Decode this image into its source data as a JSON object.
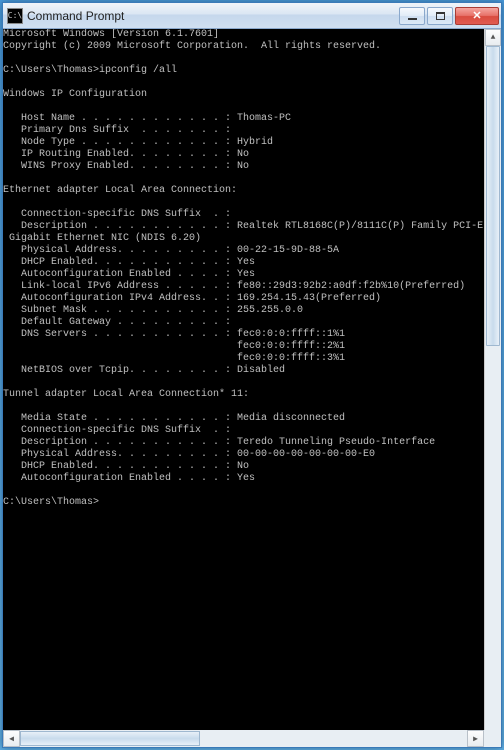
{
  "window": {
    "title": "Command Prompt"
  },
  "terminal": {
    "lines": [
      "Microsoft Windows [Version 6.1.7601]",
      "Copyright (c) 2009 Microsoft Corporation.  All rights reserved.",
      "",
      "C:\\Users\\Thomas>ipconfig /all",
      "",
      "Windows IP Configuration",
      "",
      "   Host Name . . . . . . . . . . . . : Thomas-PC",
      "   Primary Dns Suffix  . . . . . . . :",
      "   Node Type . . . . . . . . . . . . : Hybrid",
      "   IP Routing Enabled. . . . . . . . : No",
      "   WINS Proxy Enabled. . . . . . . . : No",
      "",
      "Ethernet adapter Local Area Connection:",
      "",
      "   Connection-specific DNS Suffix  . :",
      "   Description . . . . . . . . . . . : Realtek RTL8168C(P)/8111C(P) Family PCI-E",
      " Gigabit Ethernet NIC (NDIS 6.20)",
      "   Physical Address. . . . . . . . . : 00-22-15-9D-88-5A",
      "   DHCP Enabled. . . . . . . . . . . : Yes",
      "   Autoconfiguration Enabled . . . . : Yes",
      "   Link-local IPv6 Address . . . . . : fe80::29d3:92b2:a0df:f2b%10(Preferred)",
      "   Autoconfiguration IPv4 Address. . : 169.254.15.43(Preferred)",
      "   Subnet Mask . . . . . . . . . . . : 255.255.0.0",
      "   Default Gateway . . . . . . . . . :",
      "   DNS Servers . . . . . . . . . . . : fec0:0:0:ffff::1%1",
      "                                       fec0:0:0:ffff::2%1",
      "                                       fec0:0:0:ffff::3%1",
      "   NetBIOS over Tcpip. . . . . . . . : Disabled",
      "",
      "Tunnel adapter Local Area Connection* 11:",
      "",
      "   Media State . . . . . . . . . . . : Media disconnected",
      "   Connection-specific DNS Suffix  . :",
      "   Description . . . . . . . . . . . : Teredo Tunneling Pseudo-Interface",
      "   Physical Address. . . . . . . . . : 00-00-00-00-00-00-00-E0",
      "   DHCP Enabled. . . . . . . . . . . : No",
      "   Autoconfiguration Enabled . . . . : Yes",
      "",
      "C:\\Users\\Thomas>"
    ]
  }
}
